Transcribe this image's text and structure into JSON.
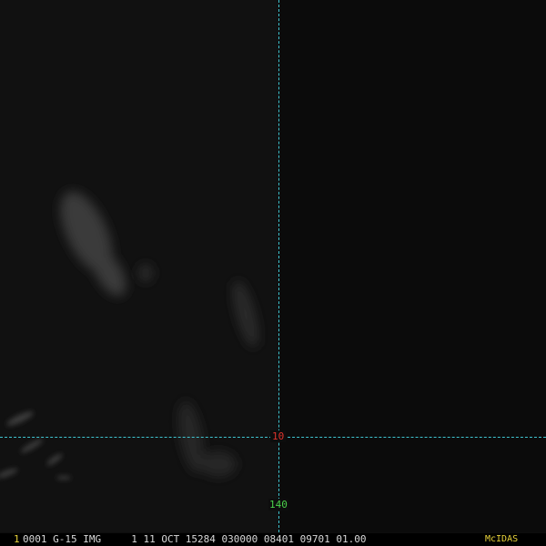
{
  "overlay": {
    "lat_label": "10",
    "lon_label": "140",
    "grid_color": "#3fc4d0",
    "lat_label_color": "#e0342c",
    "lon_label_color": "#4ad04a"
  },
  "status_bar": {
    "frame_number": "1",
    "text": "0001 G-15 IMG     1 11 OCT 15284 030000 08401 09701 01.00",
    "logo": "McIDAS",
    "accent_color": "#e8d23a"
  }
}
